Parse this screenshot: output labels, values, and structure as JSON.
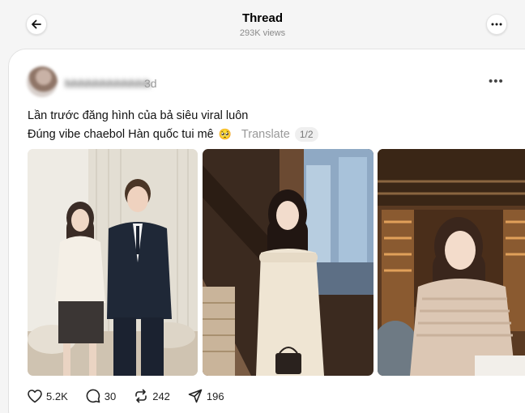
{
  "header": {
    "title": "Thread",
    "views": "293K views",
    "back_icon": "arrow-left-icon",
    "more_icon": "more-horizontal-icon"
  },
  "post": {
    "time": "3d",
    "text_line1": "Lần trước đăng hình của bả siêu viral luôn",
    "text_line2": "Đúng vibe chaebol Hàn quốc tui mê",
    "emoji": "🥺",
    "translate_label": "Translate",
    "page_indicator": "1/2",
    "photos": [
      {
        "name": "photo-woman-and-man-suit"
      },
      {
        "name": "photo-woman-cream-dress"
      },
      {
        "name": "photo-woman-restaurant"
      }
    ],
    "actions": {
      "likes": "5.2K",
      "comments": "30",
      "reposts": "242",
      "shares": "196"
    }
  },
  "colors": {
    "background": "#f5f5f5",
    "card": "#ffffff",
    "muted_text": "#999999"
  }
}
